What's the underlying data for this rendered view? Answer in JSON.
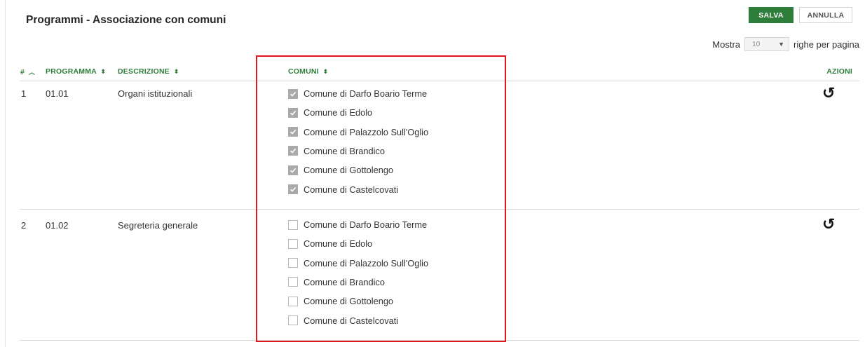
{
  "header": {
    "title": "Programmi - Associazione con comuni",
    "save_label": "SALVA",
    "cancel_label": "ANNULLA"
  },
  "pagination": {
    "show_label": "Mostra",
    "rows_value": "10",
    "rows_suffix": "righe per pagina"
  },
  "table": {
    "columns": {
      "index": "#",
      "programma": "PROGRAMMA",
      "descrizione": "DESCRIZIONE",
      "comuni": "COMUNI",
      "azioni": "AZIONI"
    },
    "rows": [
      {
        "index": "1",
        "programma": "01.01",
        "descrizione": "Organi istituzionali",
        "comuni": [
          {
            "label": "Comune di Darfo Boario Terme",
            "checked": true
          },
          {
            "label": "Comune di Edolo",
            "checked": true
          },
          {
            "label": "Comune di Palazzolo Sull'Oglio",
            "checked": true
          },
          {
            "label": "Comune di Brandico",
            "checked": true
          },
          {
            "label": "Comune di Gottolengo",
            "checked": true
          },
          {
            "label": "Comune di Castelcovati",
            "checked": true
          }
        ],
        "action_icon": "undo-icon"
      },
      {
        "index": "2",
        "programma": "01.02",
        "descrizione": "Segreteria generale",
        "comuni": [
          {
            "label": "Comune di Darfo Boario Terme",
            "checked": false
          },
          {
            "label": "Comune di Edolo",
            "checked": false
          },
          {
            "label": "Comune di Palazzolo Sull'Oglio",
            "checked": false
          },
          {
            "label": "Comune di Brandico",
            "checked": false
          },
          {
            "label": "Comune di Gottolengo",
            "checked": false
          },
          {
            "label": "Comune di Castelcovati",
            "checked": false
          }
        ],
        "action_icon": "undo-icon"
      }
    ]
  },
  "colors": {
    "accent": "#2e7d3a",
    "highlight": "#e3161b"
  }
}
